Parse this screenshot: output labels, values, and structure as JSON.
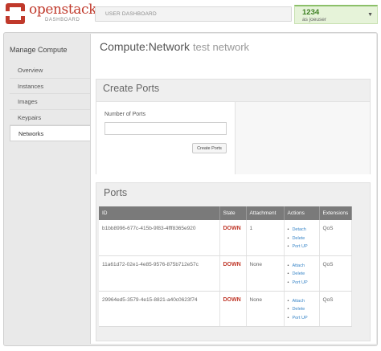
{
  "header": {
    "brand": "openstack",
    "brand_sub": "DASHBOARD",
    "dashboard_label": "USER DASHBOARD",
    "user_name": "1234",
    "user_role": "as joeuser"
  },
  "sidebar": {
    "title": "Manage Compute",
    "items": [
      {
        "label": "Overview"
      },
      {
        "label": "Instances"
      },
      {
        "label": "Images"
      },
      {
        "label": "Keypairs"
      },
      {
        "label": "Networks",
        "active": true
      }
    ]
  },
  "main": {
    "title": "Compute:Network",
    "subtitle": "test network",
    "create_ports": {
      "title": "Create Ports",
      "field_label": "Number of Ports",
      "field_value": "",
      "button_label": "Create Ports"
    },
    "ports": {
      "title": "Ports",
      "columns": [
        "ID",
        "State",
        "Attachment",
        "Actions",
        "Extensions"
      ],
      "rows": [
        {
          "id": "b1bb8996-677c-415b-9f83-4fff8365e920",
          "state": "DOWN",
          "attachment": "1",
          "actions": [
            "Detach",
            "Delete",
            "Port UP"
          ],
          "extensions": "QoS"
        },
        {
          "id": "11a61d72-02e1-4e85-9576-875b712e57c",
          "state": "DOWN",
          "attachment": "None",
          "actions": [
            "Attach",
            "Delete",
            "Port UP"
          ],
          "extensions": "QoS"
        },
        {
          "id": "29964ed5-3579-4e15-8821-a40c0623f74",
          "state": "DOWN",
          "attachment": "None",
          "actions": [
            "Attach",
            "Delete",
            "Port UP"
          ],
          "extensions": "QoS"
        }
      ]
    }
  },
  "colors": {
    "brand_red": "#c0392b",
    "state_down": "#c0392b",
    "link_blue": "#3a86c8",
    "user_green": "#3d7f22",
    "table_header": "#7a7a7a"
  }
}
